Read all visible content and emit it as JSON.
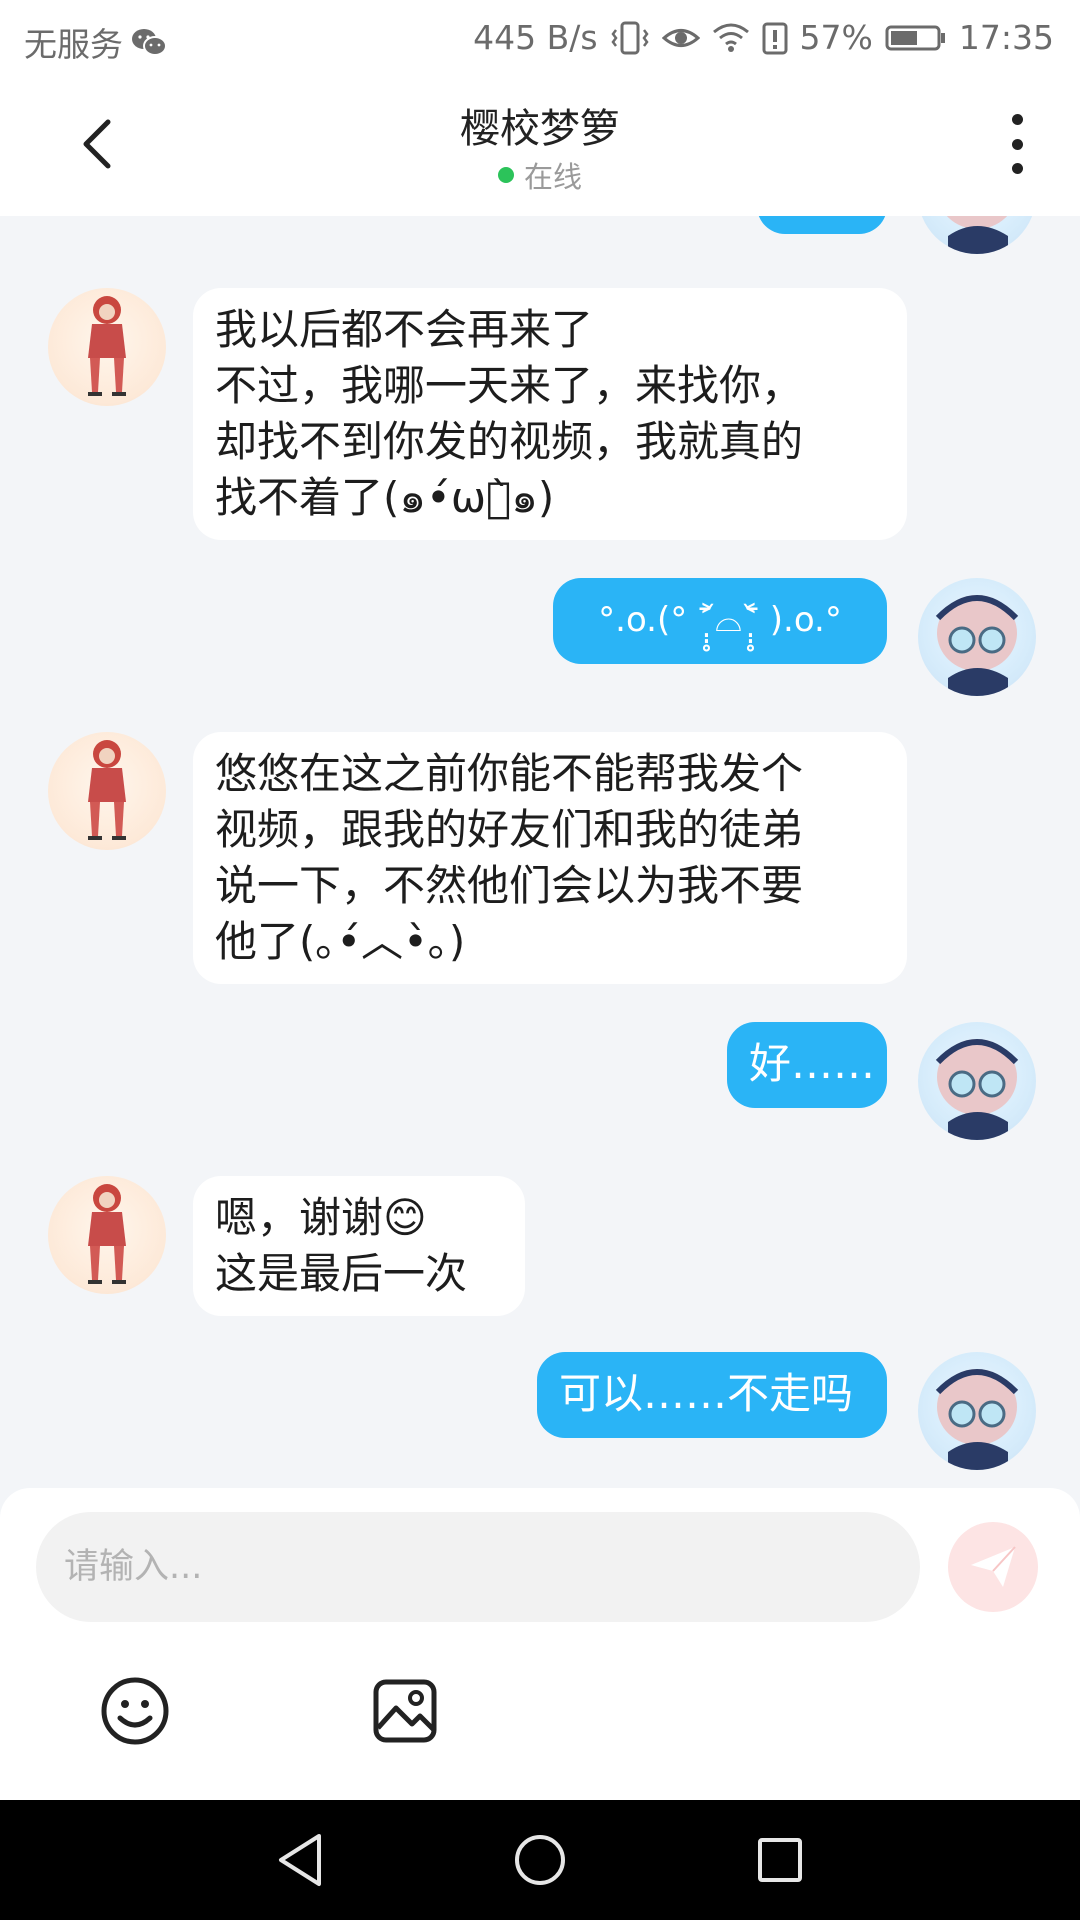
{
  "status_bar": {
    "carrier": "无服务",
    "net_speed": "445 B/s",
    "battery": "57%",
    "time": "17:35",
    "icons": [
      "wechat-icon",
      "vibrate-icon",
      "eye-icon",
      "wifi-icon",
      "battery-alert-icon",
      "battery-icon"
    ]
  },
  "header": {
    "title": "樱校梦箩",
    "status": "在线",
    "status_color": "#2cc35a"
  },
  "messages": [
    {
      "side": "left",
      "text": "我以后都不会再来了\n不过，我哪一天来了，来找你，\n却找不到你发的视频，我就真的\n找不着了(๑•́ωก̀๑)"
    },
    {
      "side": "right",
      "text": "°.o.(° ˃̣̣̥᷄⌓˂̣̣̥᷅ ).o.°"
    },
    {
      "side": "left",
      "text": "悠悠在这之前你能不能帮我发个\n视频，跟我的好友们和我的徒弟\n说一下，不然他们会以为我不要\n他了(｡•́︿•̀｡)"
    },
    {
      "side": "right",
      "text": "好……"
    },
    {
      "side": "left",
      "text": "嗯，谢谢😊\n这是最后一次"
    },
    {
      "side": "right",
      "text": "可以……不走吗"
    }
  ],
  "input": {
    "placeholder": "请输入..."
  },
  "toolbar": {
    "icons": [
      "emoji-icon",
      "image-icon",
      "send-icon"
    ]
  },
  "colors": {
    "accent": "#2ab4f6",
    "background": "#f3f5f8",
    "send_button": "#fde4e4"
  }
}
